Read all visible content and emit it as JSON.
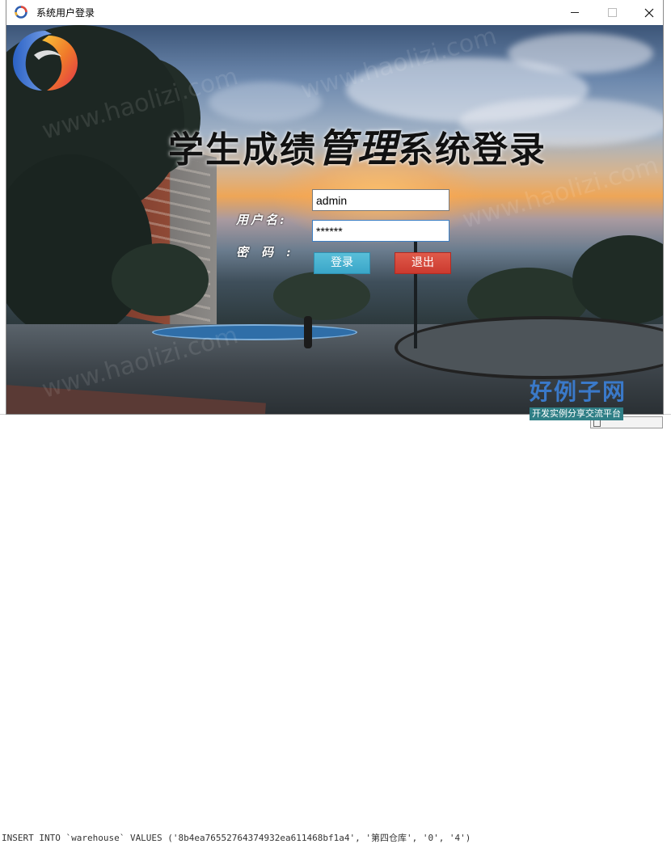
{
  "window": {
    "title": "系统用户登录"
  },
  "heading": {
    "part1": "学生成绩",
    "part2": "管理",
    "part3": "系统登录"
  },
  "form": {
    "username_label": "用户名:",
    "password_label": "密码:",
    "username_value": "admin",
    "password_value": "******",
    "login_button": "登录",
    "exit_button": "退出"
  },
  "watermark": {
    "text": "www.haolizi.com"
  },
  "site_logo": {
    "name": "好例子网",
    "slogan": "开发实例分享交流平台"
  },
  "background_app": {
    "sql_line": "INSERT INTO `warehouse` VALUES ('8b4ea76552764374932ea611468bf1a4', '第四仓库', '0', '4')"
  },
  "colors": {
    "login_button": "#3aa6c8",
    "exit_button": "#cb3a2f",
    "site_logo_blue": "#3a79c9"
  }
}
